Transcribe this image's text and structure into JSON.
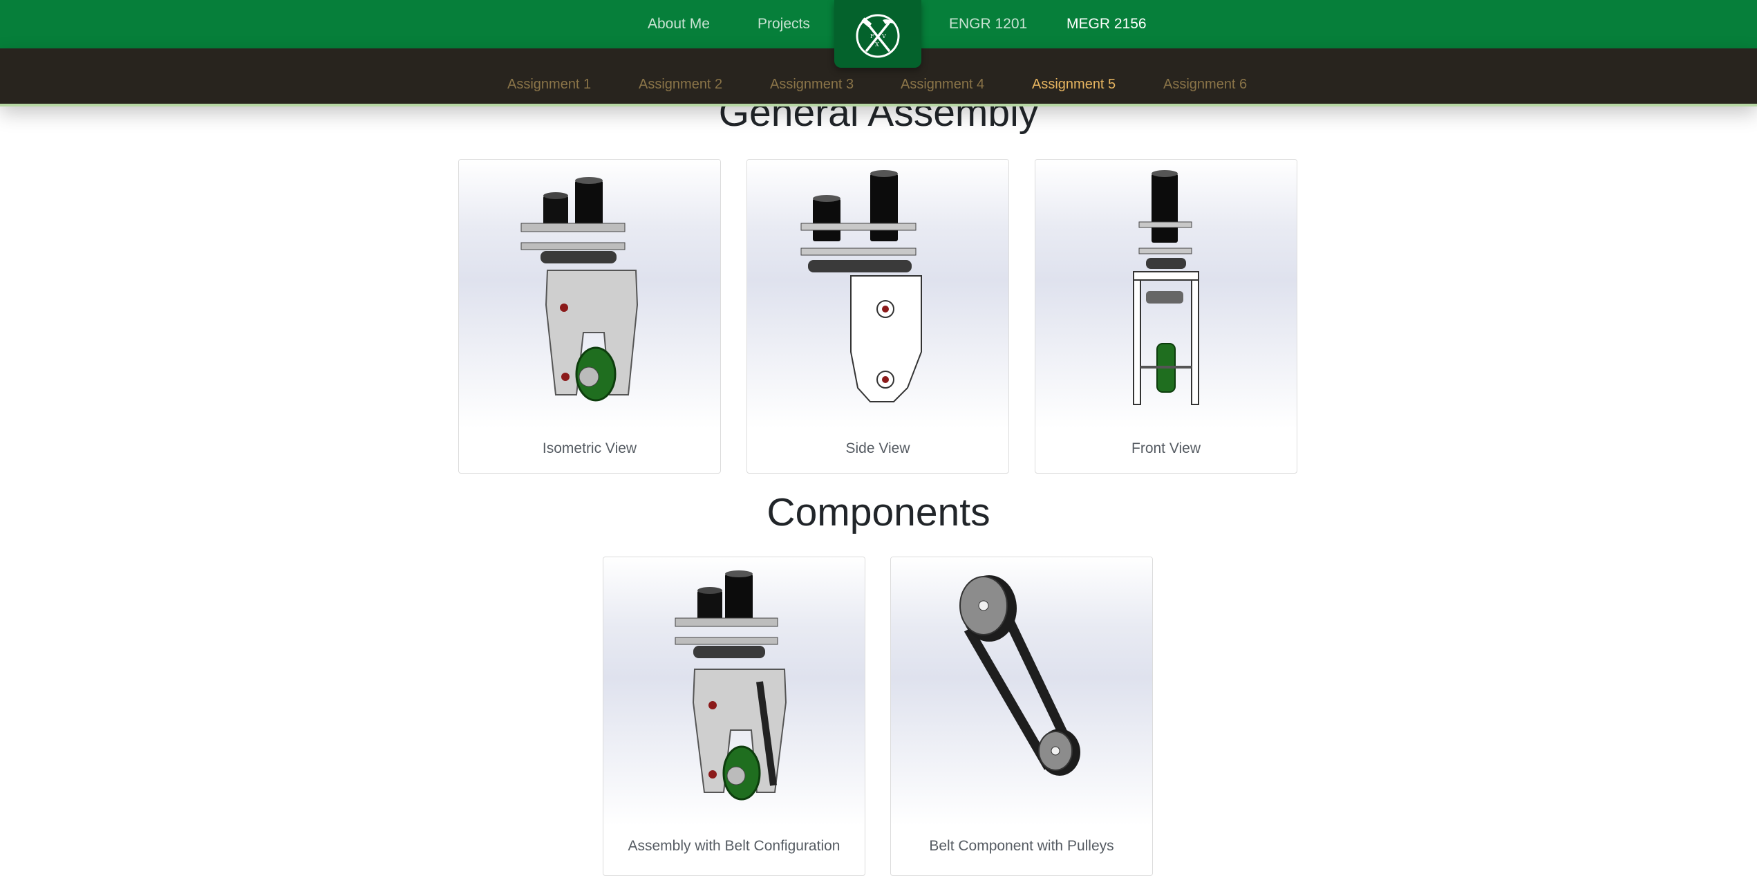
{
  "top_nav": {
    "links": [
      {
        "label": "About Me"
      },
      {
        "label": "Projects"
      },
      {
        "label": "ENGR 1201"
      },
      {
        "label": "MEGR 2156",
        "active": true
      }
    ],
    "logo": {
      "icon": "crossed-hammer-pick-icon",
      "monogram": "FXV"
    }
  },
  "sub_nav": {
    "items": [
      {
        "label": "Assignment 1"
      },
      {
        "label": "Assignment 2"
      },
      {
        "label": "Assignment 3"
      },
      {
        "label": "Assignment 4"
      },
      {
        "label": "Assignment 5",
        "active": true
      },
      {
        "label": "Assignment 6"
      }
    ]
  },
  "general_assembly": {
    "title": "General Assembly",
    "cards": [
      {
        "caption": "Isometric View"
      },
      {
        "caption": "Side View"
      },
      {
        "caption": "Front View"
      }
    ]
  },
  "components": {
    "title": "Components",
    "cards": [
      {
        "caption": "Assembly with Belt Configuration"
      },
      {
        "caption": "Belt Component with Pulleys"
      }
    ]
  },
  "colors": {
    "top_nav_bg": "#067f3a",
    "sub_nav_bg": "#28241e",
    "sub_nav_active": "#e7b560",
    "sub_nav_text": "#8a7448",
    "accent_line": "#b7d8a4"
  }
}
